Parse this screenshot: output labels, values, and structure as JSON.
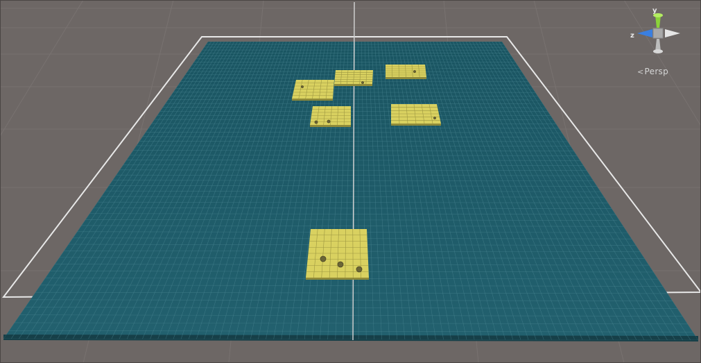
{
  "view": {
    "projection_label": "Persp",
    "axes": {
      "y": "y",
      "z": "z"
    }
  },
  "colors": {
    "background": "#6d6765",
    "ocean": "#1e5a68",
    "ocean_grid": "#4f8a96",
    "island": "#d9d160",
    "island_grid": "#9c9640",
    "boundary": "#e8e8e8",
    "gizmo_y": "#8bd23a",
    "gizmo_z": "#3a7fe0",
    "gizmo_x": "#e0e0e0"
  },
  "icons": {
    "gizmo": "scene-orientation-gizmo-icon",
    "persp": "perspective-indicator-icon"
  }
}
